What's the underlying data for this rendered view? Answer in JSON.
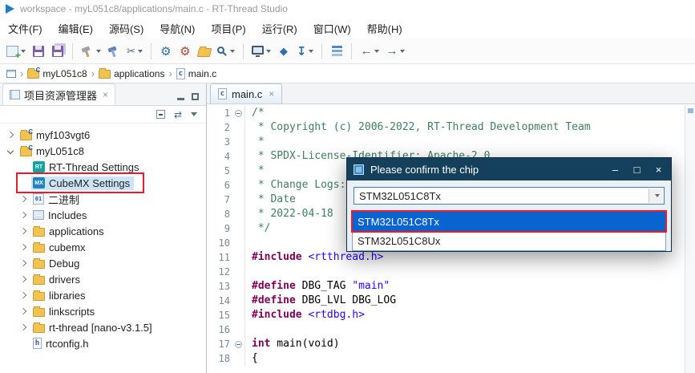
{
  "colors": {
    "select-blue": "#0a64d0",
    "tree-select": "#cde4f7",
    "dialog-title-bg": "#15405c",
    "annotation-red": "#ea1c2c",
    "comment-green": "#3f7f5f",
    "directive-maroon": "#7f0055",
    "literal-blue": "#2a00ff",
    "folder-yellow": "#f3c34f"
  },
  "icons": {
    "rt": "RT",
    "mx": "MX",
    "binary": "01",
    "hfile": "h",
    "cfile": "c",
    "scissors": "✂",
    "gear-blue": "⚙",
    "gear-red": "⚙",
    "diamond": "◆",
    "download": "↧",
    "back": "←",
    "forward": "→",
    "linked": "⇄",
    "win-min": "–",
    "win-max": "□",
    "win-close": "×",
    "crumb-sep": "›"
  },
  "window": {
    "title": "workspace - myL051c8/applications/main.c - RT-Thread Studio"
  },
  "menu": {
    "items": [
      "文件(F)",
      "编辑(E)",
      "源码(S)",
      "导航(N)",
      "项目(P)",
      "运行(R)",
      "窗口(W)",
      "帮助(H)"
    ]
  },
  "toolbar": {
    "buttons": [
      {
        "name": "new-wizard-button",
        "icon": "new",
        "dropdown": true
      },
      {
        "name": "save-button",
        "icon": "floppy"
      },
      {
        "name": "save-all-button",
        "icon": "floppy2"
      },
      {
        "name": "build-button",
        "icon": "hammer",
        "dropdown": true,
        "sep": true
      },
      {
        "name": "build-all-button",
        "icon": "hammer2"
      },
      {
        "name": "clean-build-button",
        "icon": "scissors",
        "dropdown": true
      },
      {
        "name": "debug-config-button",
        "icon": "gear-blue",
        "sep": true
      },
      {
        "name": "run-config-button",
        "icon": "gear-red"
      },
      {
        "name": "open-resource-button",
        "icon": "folder-open"
      },
      {
        "name": "search-button",
        "icon": "search",
        "dropdown": true
      },
      {
        "name": "terminal-button",
        "icon": "console",
        "dropdown": true,
        "sep": true
      },
      {
        "name": "packages-button",
        "icon": "diamond"
      },
      {
        "name": "download-button",
        "icon": "download",
        "dropdown": true
      },
      {
        "name": "debug-view-button",
        "icon": "layers",
        "sep": true
      },
      {
        "name": "back-button",
        "icon": "back",
        "dropdown": true,
        "sep": true
      },
      {
        "name": "forward-button",
        "icon": "forward",
        "dropdown": true
      }
    ]
  },
  "breadcrumb": {
    "items": [
      {
        "icon": "view",
        "label": ""
      },
      {
        "icon": "project",
        "label": "myL051c8"
      },
      {
        "icon": "folder",
        "label": "applications"
      },
      {
        "icon": "cfile",
        "label": "main.c"
      }
    ]
  },
  "explorer": {
    "title": "项目资源管理器",
    "tree": [
      {
        "name": "project-myf103vgt6",
        "label": "myf103vgt6",
        "depth": 0,
        "state": "collapsed",
        "icon": "project"
      },
      {
        "name": "project-myl051c8",
        "label": "myL051c8",
        "depth": 0,
        "state": "expanded",
        "icon": "project"
      },
      {
        "name": "rt-thread-settings",
        "label": "RT-Thread Settings",
        "depth": 1,
        "state": "leaf",
        "icon": "rt"
      },
      {
        "name": "cubemx-settings",
        "label": "CubeMX Settings",
        "depth": 1,
        "state": "leaf",
        "icon": "mx",
        "selected": true,
        "annotated": true
      },
      {
        "name": "binary-folder",
        "label": "二进制",
        "depth": 1,
        "state": "collapsed",
        "icon": "binary"
      },
      {
        "name": "includes",
        "label": "Includes",
        "depth": 1,
        "state": "collapsed",
        "icon": "includes"
      },
      {
        "name": "applications-folder",
        "label": "applications",
        "depth": 1,
        "state": "collapsed",
        "icon": "folder"
      },
      {
        "name": "cubemx-folder",
        "label": "cubemx",
        "depth": 1,
        "state": "collapsed",
        "icon": "folder"
      },
      {
        "name": "debug-folder",
        "label": "Debug",
        "depth": 1,
        "state": "collapsed",
        "icon": "folder"
      },
      {
        "name": "drivers-folder",
        "label": "drivers",
        "depth": 1,
        "state": "collapsed",
        "icon": "folder"
      },
      {
        "name": "libraries-folder",
        "label": "libraries",
        "depth": 1,
        "state": "collapsed",
        "icon": "folder"
      },
      {
        "name": "linkscripts-folder",
        "label": "linkscripts",
        "depth": 1,
        "state": "collapsed",
        "icon": "folder"
      },
      {
        "name": "rt-thread-nano",
        "label": "rt-thread [nano-v3.1.5]",
        "depth": 1,
        "state": "collapsed",
        "icon": "folder"
      },
      {
        "name": "rtconfig-h",
        "label": "rtconfig.h",
        "depth": 1,
        "state": "leaf",
        "icon": "hfile"
      }
    ]
  },
  "editor": {
    "tab": "main.c",
    "lines": [
      {
        "n": 1,
        "fold": true,
        "segs": [
          [
            "/*",
            "c"
          ]
        ]
      },
      {
        "n": 2,
        "segs": [
          [
            " * Copyright (c) 2006-2022, RT-Thread Development Team",
            "c"
          ]
        ]
      },
      {
        "n": 3,
        "segs": [
          [
            " *",
            "c"
          ]
        ]
      },
      {
        "n": 4,
        "segs": [
          [
            " * SPDX-License-Identifier: Apache-2.0",
            "c"
          ]
        ]
      },
      {
        "n": 5,
        "segs": [
          [
            " *",
            "c"
          ]
        ]
      },
      {
        "n": 6,
        "segs": [
          [
            " * Change Logs:",
            "c"
          ]
        ]
      },
      {
        "n": 7,
        "segs": [
          [
            " * Date",
            "c"
          ]
        ]
      },
      {
        "n": 8,
        "segs": [
          [
            " * 2022-04-18",
            "c"
          ]
        ]
      },
      {
        "n": 9,
        "segs": [
          [
            " */",
            "c"
          ]
        ]
      },
      {
        "n": 10,
        "segs": []
      },
      {
        "n": 11,
        "segs": [
          [
            "#include",
            "d"
          ],
          [
            " ",
            "p"
          ],
          [
            "<rtthread.h>",
            "h"
          ]
        ]
      },
      {
        "n": 12,
        "segs": []
      },
      {
        "n": 13,
        "segs": [
          [
            "#define",
            "d"
          ],
          [
            " DBG_TAG ",
            "p"
          ],
          [
            "\"main\"",
            "s"
          ]
        ]
      },
      {
        "n": 14,
        "segs": [
          [
            "#define",
            "d"
          ],
          [
            " DBG_LVL DBG_LOG",
            "p"
          ]
        ]
      },
      {
        "n": 15,
        "segs": [
          [
            "#include",
            "d"
          ],
          [
            " ",
            "p"
          ],
          [
            "<rtdbg.h>",
            "h"
          ]
        ]
      },
      {
        "n": 16,
        "segs": []
      },
      {
        "n": 17,
        "fold": true,
        "segs": [
          [
            "int",
            "k"
          ],
          [
            " main(void)",
            "p"
          ]
        ]
      },
      {
        "n": 18,
        "segs": [
          [
            "{",
            "p"
          ]
        ]
      }
    ]
  },
  "dialog": {
    "title": "Please confirm the chip",
    "combo_value": "STM32L051C8Tx",
    "options": [
      "STM32L051C8Tx",
      "STM32L051C8Ux"
    ],
    "selected_index": 0
  }
}
